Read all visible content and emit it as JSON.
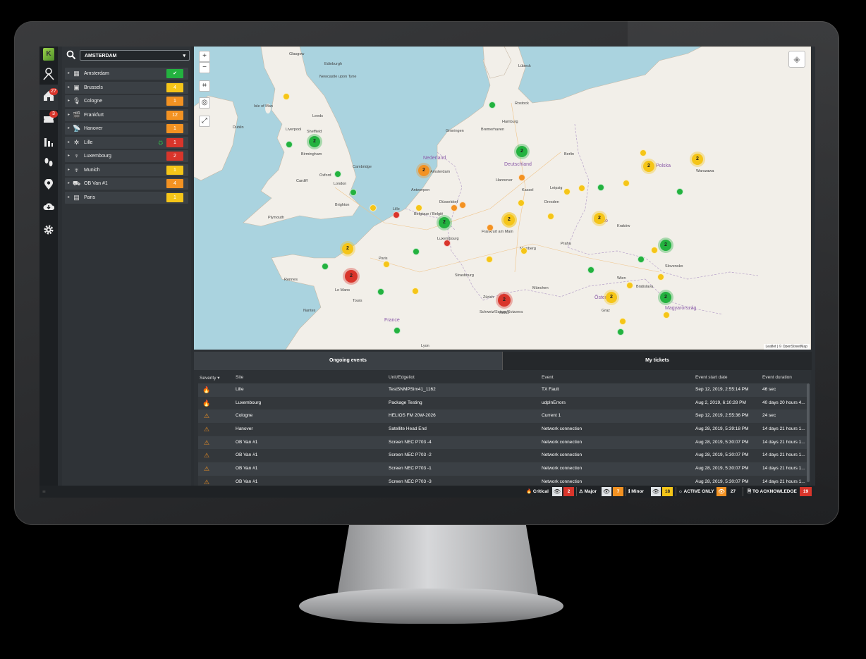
{
  "rail": {
    "home_badge": "27",
    "tickets_badge": "3"
  },
  "search": {
    "selected_city": "AMSTERDAM"
  },
  "sites": [
    {
      "name": "Amsterdam",
      "count": "✔",
      "color": "#23b23f",
      "icon": "building-icon"
    },
    {
      "name": "Brussels",
      "count": "4",
      "color": "#f5c518",
      "icon": "image-icon"
    },
    {
      "name": "Cologne",
      "count": "1",
      "color": "#f39222",
      "icon": "microphone-icon"
    },
    {
      "name": "Frankfurt",
      "count": "12",
      "color": "#f39222",
      "icon": "clapperboard-icon"
    },
    {
      "name": "Hanover",
      "count": "1",
      "color": "#f39222",
      "icon": "satellite-dish-icon"
    },
    {
      "name": "Lille",
      "count": "1",
      "color": "#d9352b",
      "icon": "satellite-icon"
    },
    {
      "name": "Luxembourg",
      "count": "2",
      "color": "#d9352b",
      "icon": "antenna-icon"
    },
    {
      "name": "Munich",
      "count": "1",
      "color": "#f5c518",
      "icon": "broadcast-tower-icon"
    },
    {
      "name": "OB Van #1",
      "count": "4",
      "color": "#f39222",
      "icon": "truck-icon"
    },
    {
      "name": "Paris",
      "count": "1",
      "color": "#f5c518",
      "icon": "server-icon"
    }
  ],
  "map": {
    "zoom_in": "+",
    "zoom_out": "−",
    "attribution": "Leaflet | © OpenStreetMap",
    "places": [
      "Glasgow",
      "Edinburgh",
      "Newcastle upon Tyne",
      "Isle of Man",
      "Leeds",
      "Dublin",
      "Liverpool",
      "Sheffield",
      "Birmingham",
      "Cambridge",
      "Oxford",
      "London",
      "Cardiff",
      "Brighton",
      "Plymouth",
      "Hamburg",
      "Groningen",
      "Bremerhaven",
      "Nederland",
      "Deutschland",
      "Berlin",
      "Amsterdam",
      "Antwerpen",
      "Lille",
      "Düsseldorf",
      "Belgique / België",
      "Frankfurt am Main",
      "Luxembourg",
      "Paris",
      "Strasbourg",
      "Nürnberg",
      "München",
      "Praha",
      "Česko",
      "Polska",
      "Warszawa",
      "Kraków",
      "Wien",
      "Bratislava",
      "Österreich",
      "Magyarország",
      "Schweiz/Suisse/Svizzera",
      "Rennes",
      "Le Mans",
      "Tours",
      "Nantes",
      "Lyon",
      "France",
      "Slovensko",
      "Zürich",
      "Vaduz",
      "Graz",
      "Rostock",
      "Lübeck",
      "Dresden",
      "Leipzig",
      "Kassel",
      "Hannover"
    ],
    "clusters": [
      {
        "label": "2",
        "color": "green"
      },
      {
        "label": "2",
        "color": "orange"
      },
      {
        "label": "2",
        "color": "green"
      },
      {
        "label": "2",
        "color": "yellow"
      },
      {
        "label": "2",
        "color": "yellow"
      },
      {
        "label": "2",
        "color": "yellow"
      },
      {
        "label": "2",
        "color": "green"
      },
      {
        "label": "2",
        "color": "yellow"
      },
      {
        "label": "2",
        "color": "yellow"
      },
      {
        "label": "2",
        "color": "green"
      },
      {
        "label": "2",
        "color": "yellow"
      },
      {
        "label": "2",
        "color": "red"
      },
      {
        "label": "2",
        "color": "yellow"
      },
      {
        "label": "2",
        "color": "green"
      },
      {
        "label": "2",
        "color": "red"
      }
    ]
  },
  "events": {
    "tab_ongoing": "Ongoing events",
    "tab_tickets": "My tickets",
    "columns": {
      "severity": "Severity",
      "site": "Site",
      "unit": "Unit/Edgeliot",
      "event": "Event",
      "start": "Event start date",
      "duration": "Event duration"
    },
    "rows": [
      {
        "sev": "critical",
        "site": "Lille",
        "unit": "TestSNMPSim41_1162",
        "event": "TX Fault",
        "start": "Sep 12, 2019, 2:55:14 PM",
        "duration": "46 sec"
      },
      {
        "sev": "critical",
        "site": "Luxembourg",
        "unit": "Package Testing",
        "event": "udpInErrors",
        "start": "Aug 2, 2019, 6:10:28 PM",
        "duration": "40 days 20 hours 4..."
      },
      {
        "sev": "major",
        "site": "Cologne",
        "unit": "HELIOS FM 20W-2026",
        "event": "Current 1",
        "start": "Sep 12, 2019, 2:55:36 PM",
        "duration": "24 sec"
      },
      {
        "sev": "major",
        "site": "Hanover",
        "unit": "Satellite Head End",
        "event": "Network connection",
        "start": "Aug 28, 2019, 5:39:18 PM",
        "duration": "14 days 21 hours 1..."
      },
      {
        "sev": "major",
        "site": "OB Van #1",
        "unit": "Screen NEC P703 -4",
        "event": "Network connection",
        "start": "Aug 28, 2019, 5:30:07 PM",
        "duration": "14 days 21 hours 1..."
      },
      {
        "sev": "major",
        "site": "OB Van #1",
        "unit": "Screen NEC P703 -2",
        "event": "Network connection",
        "start": "Aug 28, 2019, 5:30:07 PM",
        "duration": "14 days 21 hours 1..."
      },
      {
        "sev": "major",
        "site": "OB Van #1",
        "unit": "Screen NEC P703 -1",
        "event": "Network connection",
        "start": "Aug 28, 2019, 5:30:07 PM",
        "duration": "14 days 21 hours 1..."
      },
      {
        "sev": "major",
        "site": "OB Van #1",
        "unit": "Screen NEC P703 -3",
        "event": "Network connection",
        "start": "Aug 28, 2019, 5:30:07 PM",
        "duration": "14 days 21 hours 1..."
      }
    ]
  },
  "statusbar": {
    "critical_label": "Critical",
    "critical_count": "2",
    "major_label": "Major",
    "major_count": "7",
    "minor_label": "Minor",
    "minor_count": "18",
    "active_label": "ACTIVE ONLY",
    "active_count": "27",
    "ack_label": "TO ACKNOWLEDGE",
    "ack_count": "19"
  },
  "colors": {
    "critical": "#d9352b",
    "major": "#f39222",
    "minor": "#f5c518",
    "ok": "#23b23f"
  }
}
